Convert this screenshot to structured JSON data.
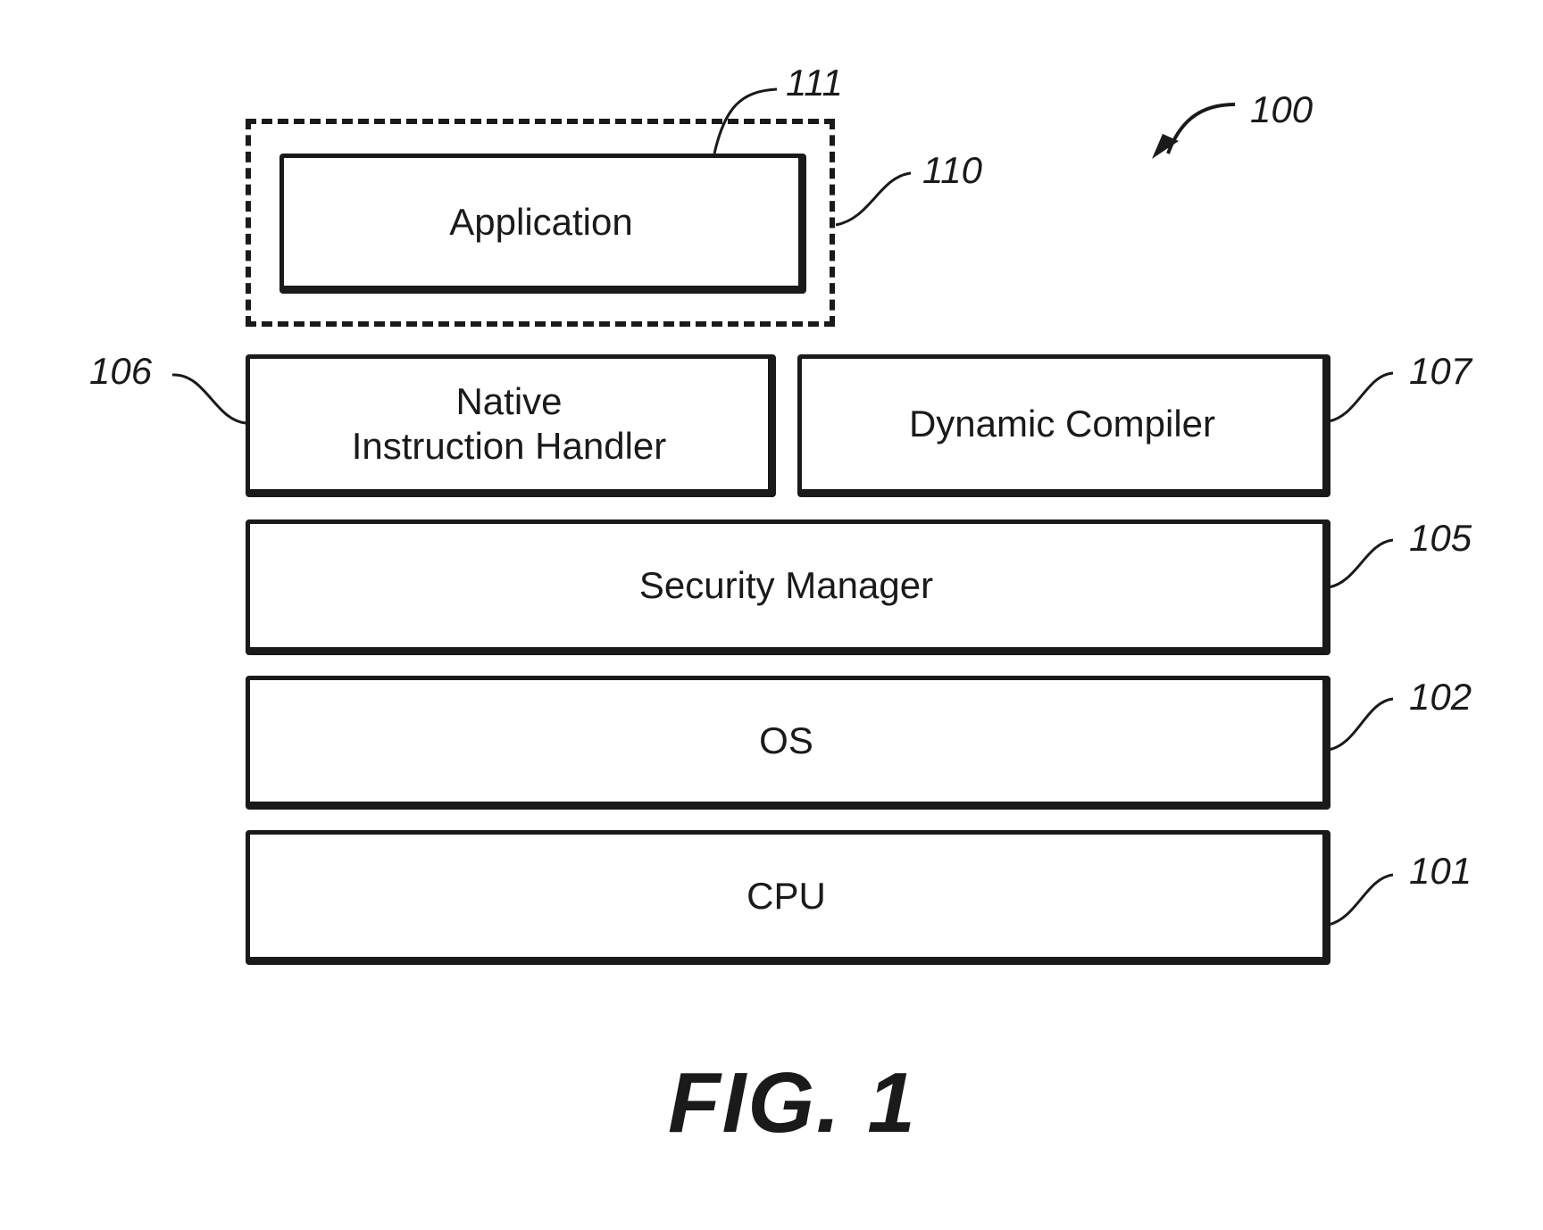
{
  "figure": {
    "label": "FIG. 1",
    "system_ref": "100"
  },
  "layers": {
    "application": {
      "label": "Application",
      "ref": "111"
    },
    "application_container": {
      "ref": "110"
    },
    "native_instruction_handler": {
      "line1": "Native",
      "line2": "Instruction Handler",
      "ref": "106"
    },
    "dynamic_compiler": {
      "label": "Dynamic Compiler",
      "ref": "107"
    },
    "security_manager": {
      "label": "Security Manager",
      "ref": "105"
    },
    "os": {
      "label": "OS",
      "ref": "102"
    },
    "cpu": {
      "label": "CPU",
      "ref": "101"
    }
  }
}
